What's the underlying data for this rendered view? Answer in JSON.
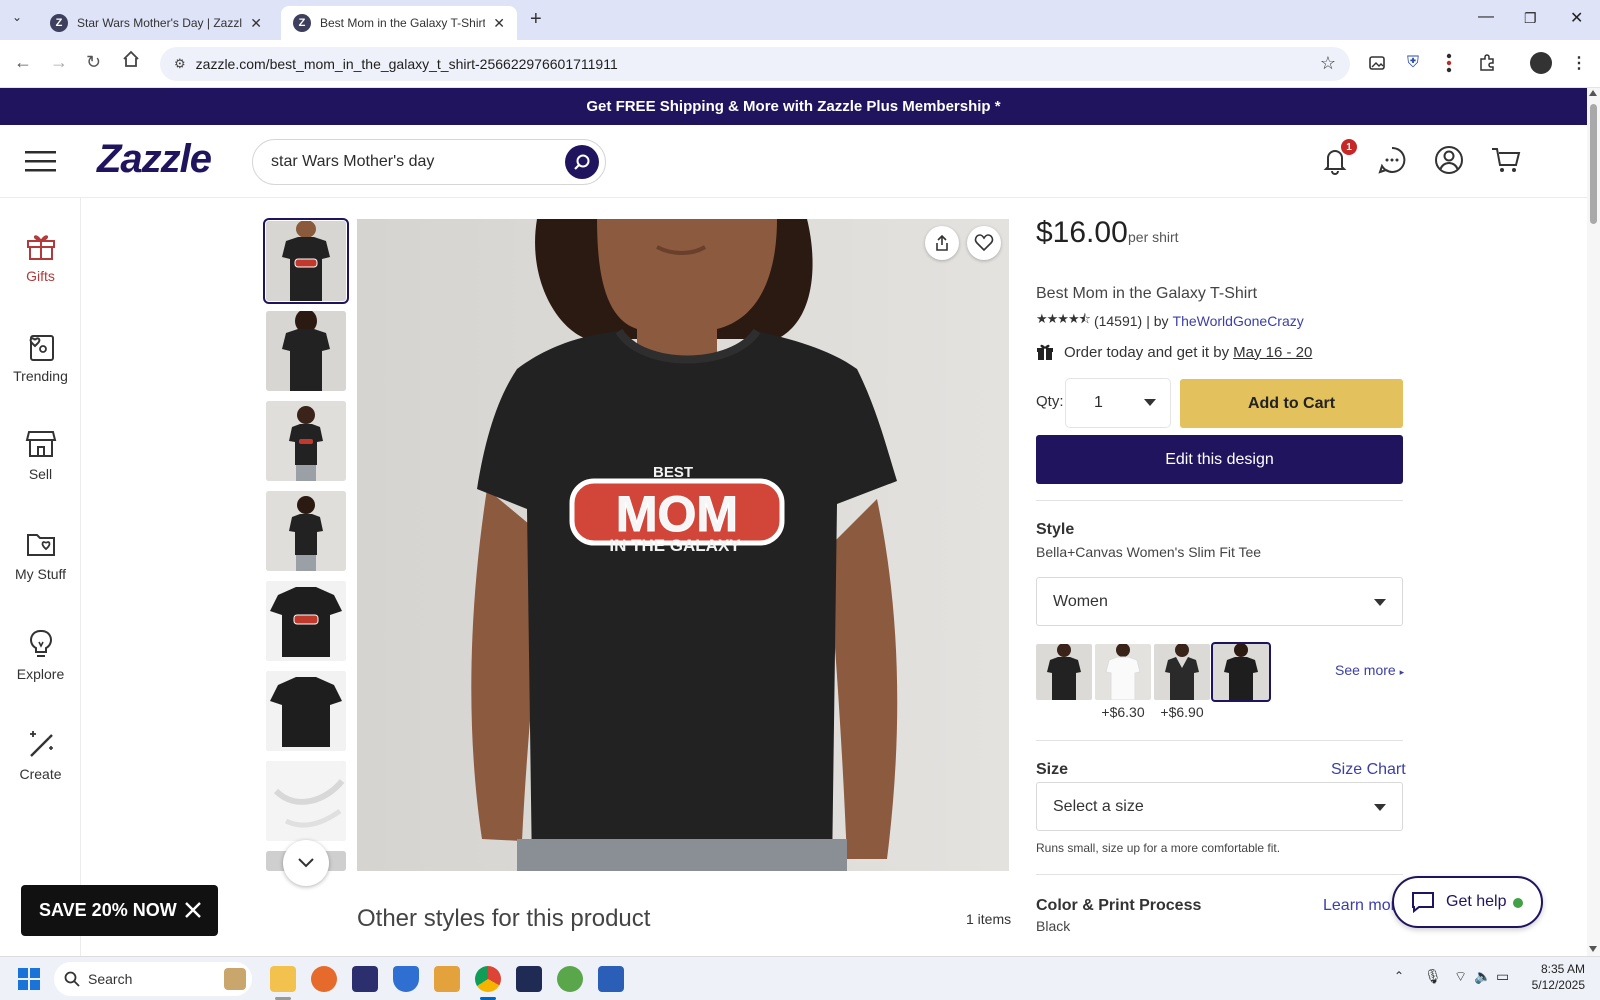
{
  "browser": {
    "tabs": [
      {
        "title": "Star Wars Mother's Day | Zazzle",
        "active": false
      },
      {
        "title": "Best Mom in the Galaxy T-Shirt | Zazzle",
        "active": true
      }
    ],
    "new_tab": "+",
    "url": "zazzle.com/best_mom_in_the_galaxy_t_shirt-256622976601711911"
  },
  "promo": {
    "text": "Get FREE Shipping & More with Zazzle Plus Membership *"
  },
  "header": {
    "logo": "Zazzle",
    "search_value": "star Wars Mother's day",
    "notification_count": "1"
  },
  "leftnav": [
    {
      "label": "Gifts"
    },
    {
      "label": "Trending"
    },
    {
      "label": "Sell"
    },
    {
      "label": "My Stuff"
    },
    {
      "label": "Explore"
    },
    {
      "label": "Create"
    }
  ],
  "product": {
    "shirt_print_top": "BEST",
    "shirt_print_main": "MOM",
    "shirt_print_bottom": "IN THE GALAXY",
    "price": "$16.00",
    "per_unit": "per shirt",
    "title": "Best Mom in the Galaxy T-Shirt",
    "rating_value": 4.5,
    "stars": "★★★★⯪",
    "review_count": "(14591)",
    "by_text": "| by",
    "seller": "TheWorldGoneCrazy",
    "delivery_text": "Order today and get it by",
    "delivery_date": "May 16 - 20",
    "qty_label": "Qty:",
    "qty_value": "1",
    "add_to_cart": "Add to Cart",
    "edit_design": "Edit this design",
    "style_heading": "Style",
    "style_value": "Bella+Canvas Women's Slim Fit Tee",
    "style_select": "Women",
    "swatch_prices": [
      "",
      "+$6.30",
      "+$6.90",
      ""
    ],
    "see_more": "See more",
    "size_heading": "Size",
    "size_chart": "Size Chart",
    "size_select": "Select a size",
    "size_note": "Runs small, size up for a more comfortable fit.",
    "color_heading": "Color & Print Process",
    "color_value": "Black",
    "learn_more": "Learn more"
  },
  "other_styles": {
    "heading": "Other styles for this product",
    "count": "1 items"
  },
  "promo_popup": {
    "label": "SAVE 20% NOW"
  },
  "help": {
    "label": "Get help"
  },
  "taskbar": {
    "search_placeholder": "Search",
    "time": "8:35 AM",
    "date": "5/12/2025"
  },
  "colors": {
    "brand": "#21145f",
    "cart": "#e3c15c",
    "link": "#3b3fa6"
  }
}
